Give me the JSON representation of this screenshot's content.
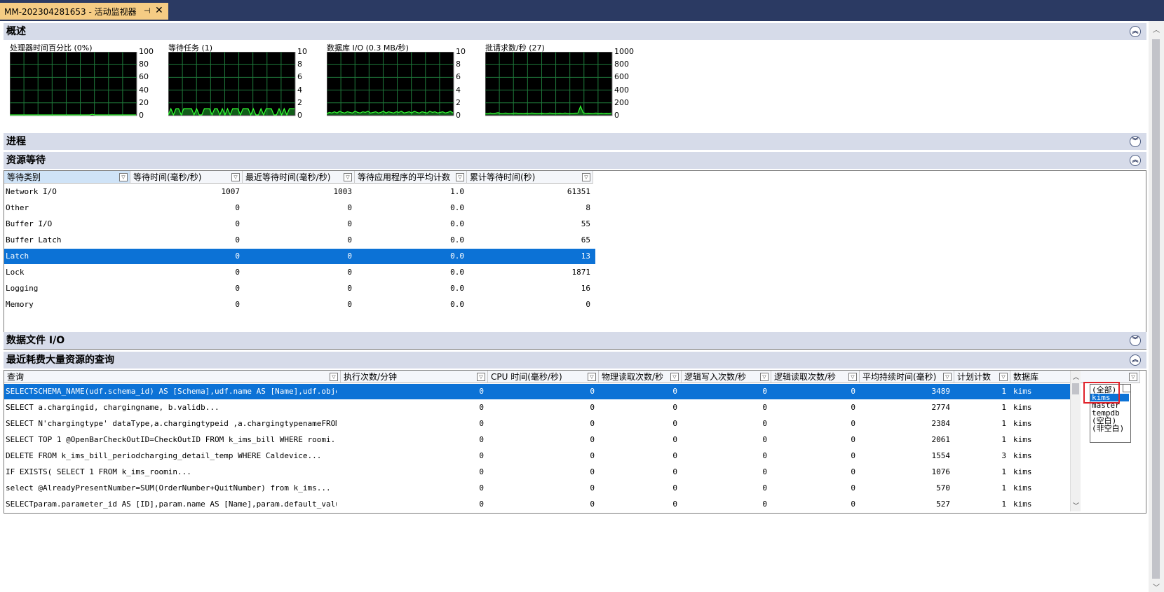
{
  "tab": {
    "title": "MM-202304281653 - 活动监视器",
    "pin": "⊣",
    "close": "✕"
  },
  "sections": {
    "overview": "概述",
    "processes": "进程",
    "resource_waits": "资源等待",
    "data_file_io": "数据文件 I/O",
    "expensive_queries": "最近耗费大量资源的查询"
  },
  "collapse_icons": {
    "up": "︽",
    "down": "︾"
  },
  "charts": [
    {
      "title": "处理器时间百分比 (0%)",
      "ticks": [
        "100",
        "80",
        "60",
        "40",
        "20",
        "0"
      ],
      "max": 100,
      "series": [
        0,
        0,
        0,
        0,
        0,
        0,
        0,
        0,
        0,
        0,
        0,
        0,
        0,
        0,
        0,
        0,
        0,
        0,
        0,
        0,
        0,
        0,
        0,
        0,
        0,
        0,
        0,
        0,
        0,
        0,
        0,
        0,
        1,
        0,
        0,
        0,
        0,
        0,
        0,
        0,
        0,
        0,
        0,
        0,
        0,
        0,
        0,
        0,
        0,
        0
      ]
    },
    {
      "title": "等待任务 (1)",
      "ticks": [
        "10",
        "8",
        "6",
        "4",
        "2",
        "0"
      ],
      "max": 10,
      "series": [
        0,
        1,
        0,
        1,
        1,
        0,
        1,
        1,
        1,
        1,
        0,
        1,
        0,
        0,
        1,
        1,
        1,
        0,
        1,
        1,
        0,
        1,
        0,
        1,
        0,
        1,
        1,
        1,
        0,
        1,
        1,
        1,
        0,
        1,
        0,
        0,
        1,
        0,
        1,
        1,
        1,
        0,
        0,
        1,
        0,
        1,
        0,
        1,
        1,
        1
      ]
    },
    {
      "title": "数据库 I/O (0.3 MB/秒)",
      "ticks": [
        "10",
        "8",
        "6",
        "4",
        "2",
        "0"
      ],
      "max": 10,
      "series": [
        0.2,
        0.4,
        0.3,
        0.5,
        0.3,
        0.6,
        0.4,
        0.3,
        0.5,
        0.4,
        0.3,
        0.6,
        0.4,
        0.3,
        0.5,
        0.4,
        0.6,
        0.3,
        0.4,
        0.5,
        0.3,
        0.4,
        0.6,
        0.3,
        0.5,
        0.4,
        0.3,
        0.5,
        0.4,
        0.6,
        0.3,
        0.4,
        0.5,
        0.3,
        0.6,
        0.4,
        0.3,
        0.5,
        0.4,
        0.3,
        0.6,
        0.4,
        0.5,
        0.3,
        0.4,
        0.5,
        0.3,
        0.4,
        0.6,
        0.3
      ]
    },
    {
      "title": "批请求数/秒 (27)",
      "ticks": [
        "1000",
        "800",
        "600",
        "400",
        "200",
        "0"
      ],
      "max": 1000,
      "series": [
        20,
        25,
        30,
        22,
        28,
        35,
        24,
        26,
        30,
        22,
        25,
        28,
        30,
        24,
        26,
        22,
        28,
        25,
        30,
        27,
        24,
        26,
        28,
        25,
        22,
        30,
        27,
        24,
        26,
        28,
        25,
        30,
        24,
        22,
        26,
        28,
        30,
        140,
        35,
        25,
        28,
        24,
        26,
        30,
        22,
        28,
        25,
        27,
        24,
        30
      ]
    }
  ],
  "waits": {
    "columns": [
      "等待类别",
      "等待时间(毫秒/秒)",
      "最近等待时间(毫秒/秒)",
      "等待应用程序的平均计数",
      "累计等待时间(秒)"
    ],
    "rows": [
      [
        "Network I/O",
        "1007",
        "1003",
        "1.0",
        "61351"
      ],
      [
        "Other",
        "0",
        "0",
        "0.0",
        "8"
      ],
      [
        "Buffer I/O",
        "0",
        "0",
        "0.0",
        "55"
      ],
      [
        "Buffer Latch",
        "0",
        "0",
        "0.0",
        "65"
      ],
      [
        "Latch",
        "0",
        "0",
        "0.0",
        "13"
      ],
      [
        "Lock",
        "0",
        "0",
        "0.0",
        "1871"
      ],
      [
        "Logging",
        "0",
        "0",
        "0.0",
        "16"
      ],
      [
        "Memory",
        "0",
        "0",
        "0.0",
        "0"
      ]
    ],
    "selected_row": 4
  },
  "queries": {
    "columns": [
      "查询",
      "执行次数/分钟",
      "CPU 时间(毫秒/秒)",
      "物理读取次数/秒",
      "逻辑写入次数/秒",
      "逻辑读取次数/秒",
      "平均持续时间(毫秒)",
      "计划计数",
      "数据库"
    ],
    "rows": [
      [
        "SELECTSCHEMA_NAME(udf.schema_id) AS [Schema],udf.name AS [Name],udf.object_...",
        "0",
        "0",
        "0",
        "0",
        "0",
        "3489",
        "1",
        "kims"
      ],
      [
        "SELECT a.chargingid,                chargingname,                b.validb...",
        "0",
        "0",
        "0",
        "0",
        "0",
        "2774",
        "1",
        "kims"
      ],
      [
        "SELECT N'chargingtype' dataType,a.chargingtypeid ,a.chargingtypenameFROM db...",
        "0",
        "0",
        "0",
        "0",
        "0",
        "2384",
        "1",
        "kims"
      ],
      [
        "SELECT  TOP 1 @OpenBarCheckOutID=CheckOutID   FROM k_ims_bill   WHERE roomi...",
        "0",
        "0",
        "0",
        "0",
        "0",
        "2061",
        "1",
        "kims"
      ],
      [
        "DELETE FROM k_ims_bill_periodcharging_detail_temp          WHERE  Caldevice...",
        "0",
        "0",
        "0",
        "0",
        "0",
        "1554",
        "3",
        "kims"
      ],
      [
        "IF EXISTS(                  SELECT 1                  FROM   k_ims_roomin...",
        "0",
        "0",
        "0",
        "0",
        "0",
        "1076",
        "1",
        "kims"
      ],
      [
        "select @AlreadyPresentNumber=SUM(OrderNumber+QuitNumber)        from k_ims...",
        "0",
        "0",
        "0",
        "0",
        "0",
        "570",
        "1",
        "kims"
      ],
      [
        "SELECTparam.parameter_id AS [ID],param.name AS [Name],param.default_value A...",
        "0",
        "0",
        "0",
        "0",
        "0",
        "527",
        "1",
        "kims"
      ]
    ],
    "selected_row": 0
  },
  "db_filter_options": [
    "(全部)",
    "kims",
    "master",
    "tempdb",
    "(空白)",
    "(非空白)"
  ],
  "db_filter_selected": 1,
  "scroll_icons": {
    "up": "︿",
    "down": "﹀"
  },
  "filter_icon": "▽"
}
